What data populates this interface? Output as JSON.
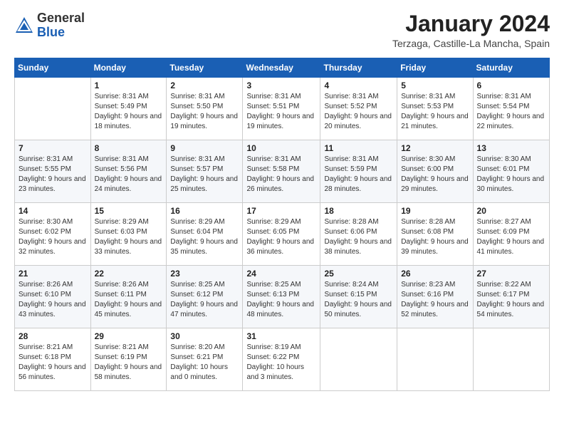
{
  "header": {
    "logo_general": "General",
    "logo_blue": "Blue",
    "month": "January 2024",
    "location": "Terzaga, Castille-La Mancha, Spain"
  },
  "weekdays": [
    "Sunday",
    "Monday",
    "Tuesday",
    "Wednesday",
    "Thursday",
    "Friday",
    "Saturday"
  ],
  "weeks": [
    [
      {
        "day": "",
        "sunrise": "",
        "sunset": "",
        "daylight": ""
      },
      {
        "day": "1",
        "sunrise": "Sunrise: 8:31 AM",
        "sunset": "Sunset: 5:49 PM",
        "daylight": "Daylight: 9 hours and 18 minutes."
      },
      {
        "day": "2",
        "sunrise": "Sunrise: 8:31 AM",
        "sunset": "Sunset: 5:50 PM",
        "daylight": "Daylight: 9 hours and 19 minutes."
      },
      {
        "day": "3",
        "sunrise": "Sunrise: 8:31 AM",
        "sunset": "Sunset: 5:51 PM",
        "daylight": "Daylight: 9 hours and 19 minutes."
      },
      {
        "day": "4",
        "sunrise": "Sunrise: 8:31 AM",
        "sunset": "Sunset: 5:52 PM",
        "daylight": "Daylight: 9 hours and 20 minutes."
      },
      {
        "day": "5",
        "sunrise": "Sunrise: 8:31 AM",
        "sunset": "Sunset: 5:53 PM",
        "daylight": "Daylight: 9 hours and 21 minutes."
      },
      {
        "day": "6",
        "sunrise": "Sunrise: 8:31 AM",
        "sunset": "Sunset: 5:54 PM",
        "daylight": "Daylight: 9 hours and 22 minutes."
      }
    ],
    [
      {
        "day": "7",
        "sunrise": "Sunrise: 8:31 AM",
        "sunset": "Sunset: 5:55 PM",
        "daylight": "Daylight: 9 hours and 23 minutes."
      },
      {
        "day": "8",
        "sunrise": "Sunrise: 8:31 AM",
        "sunset": "Sunset: 5:56 PM",
        "daylight": "Daylight: 9 hours and 24 minutes."
      },
      {
        "day": "9",
        "sunrise": "Sunrise: 8:31 AM",
        "sunset": "Sunset: 5:57 PM",
        "daylight": "Daylight: 9 hours and 25 minutes."
      },
      {
        "day": "10",
        "sunrise": "Sunrise: 8:31 AM",
        "sunset": "Sunset: 5:58 PM",
        "daylight": "Daylight: 9 hours and 26 minutes."
      },
      {
        "day": "11",
        "sunrise": "Sunrise: 8:31 AM",
        "sunset": "Sunset: 5:59 PM",
        "daylight": "Daylight: 9 hours and 28 minutes."
      },
      {
        "day": "12",
        "sunrise": "Sunrise: 8:30 AM",
        "sunset": "Sunset: 6:00 PM",
        "daylight": "Daylight: 9 hours and 29 minutes."
      },
      {
        "day": "13",
        "sunrise": "Sunrise: 8:30 AM",
        "sunset": "Sunset: 6:01 PM",
        "daylight": "Daylight: 9 hours and 30 minutes."
      }
    ],
    [
      {
        "day": "14",
        "sunrise": "Sunrise: 8:30 AM",
        "sunset": "Sunset: 6:02 PM",
        "daylight": "Daylight: 9 hours and 32 minutes."
      },
      {
        "day": "15",
        "sunrise": "Sunrise: 8:29 AM",
        "sunset": "Sunset: 6:03 PM",
        "daylight": "Daylight: 9 hours and 33 minutes."
      },
      {
        "day": "16",
        "sunrise": "Sunrise: 8:29 AM",
        "sunset": "Sunset: 6:04 PM",
        "daylight": "Daylight: 9 hours and 35 minutes."
      },
      {
        "day": "17",
        "sunrise": "Sunrise: 8:29 AM",
        "sunset": "Sunset: 6:05 PM",
        "daylight": "Daylight: 9 hours and 36 minutes."
      },
      {
        "day": "18",
        "sunrise": "Sunrise: 8:28 AM",
        "sunset": "Sunset: 6:06 PM",
        "daylight": "Daylight: 9 hours and 38 minutes."
      },
      {
        "day": "19",
        "sunrise": "Sunrise: 8:28 AM",
        "sunset": "Sunset: 6:08 PM",
        "daylight": "Daylight: 9 hours and 39 minutes."
      },
      {
        "day": "20",
        "sunrise": "Sunrise: 8:27 AM",
        "sunset": "Sunset: 6:09 PM",
        "daylight": "Daylight: 9 hours and 41 minutes."
      }
    ],
    [
      {
        "day": "21",
        "sunrise": "Sunrise: 8:26 AM",
        "sunset": "Sunset: 6:10 PM",
        "daylight": "Daylight: 9 hours and 43 minutes."
      },
      {
        "day": "22",
        "sunrise": "Sunrise: 8:26 AM",
        "sunset": "Sunset: 6:11 PM",
        "daylight": "Daylight: 9 hours and 45 minutes."
      },
      {
        "day": "23",
        "sunrise": "Sunrise: 8:25 AM",
        "sunset": "Sunset: 6:12 PM",
        "daylight": "Daylight: 9 hours and 47 minutes."
      },
      {
        "day": "24",
        "sunrise": "Sunrise: 8:25 AM",
        "sunset": "Sunset: 6:13 PM",
        "daylight": "Daylight: 9 hours and 48 minutes."
      },
      {
        "day": "25",
        "sunrise": "Sunrise: 8:24 AM",
        "sunset": "Sunset: 6:15 PM",
        "daylight": "Daylight: 9 hours and 50 minutes."
      },
      {
        "day": "26",
        "sunrise": "Sunrise: 8:23 AM",
        "sunset": "Sunset: 6:16 PM",
        "daylight": "Daylight: 9 hours and 52 minutes."
      },
      {
        "day": "27",
        "sunrise": "Sunrise: 8:22 AM",
        "sunset": "Sunset: 6:17 PM",
        "daylight": "Daylight: 9 hours and 54 minutes."
      }
    ],
    [
      {
        "day": "28",
        "sunrise": "Sunrise: 8:21 AM",
        "sunset": "Sunset: 6:18 PM",
        "daylight": "Daylight: 9 hours and 56 minutes."
      },
      {
        "day": "29",
        "sunrise": "Sunrise: 8:21 AM",
        "sunset": "Sunset: 6:19 PM",
        "daylight": "Daylight: 9 hours and 58 minutes."
      },
      {
        "day": "30",
        "sunrise": "Sunrise: 8:20 AM",
        "sunset": "Sunset: 6:21 PM",
        "daylight": "Daylight: 10 hours and 0 minutes."
      },
      {
        "day": "31",
        "sunrise": "Sunrise: 8:19 AM",
        "sunset": "Sunset: 6:22 PM",
        "daylight": "Daylight: 10 hours and 3 minutes."
      },
      {
        "day": "",
        "sunrise": "",
        "sunset": "",
        "daylight": ""
      },
      {
        "day": "",
        "sunrise": "",
        "sunset": "",
        "daylight": ""
      },
      {
        "day": "",
        "sunrise": "",
        "sunset": "",
        "daylight": ""
      }
    ]
  ]
}
